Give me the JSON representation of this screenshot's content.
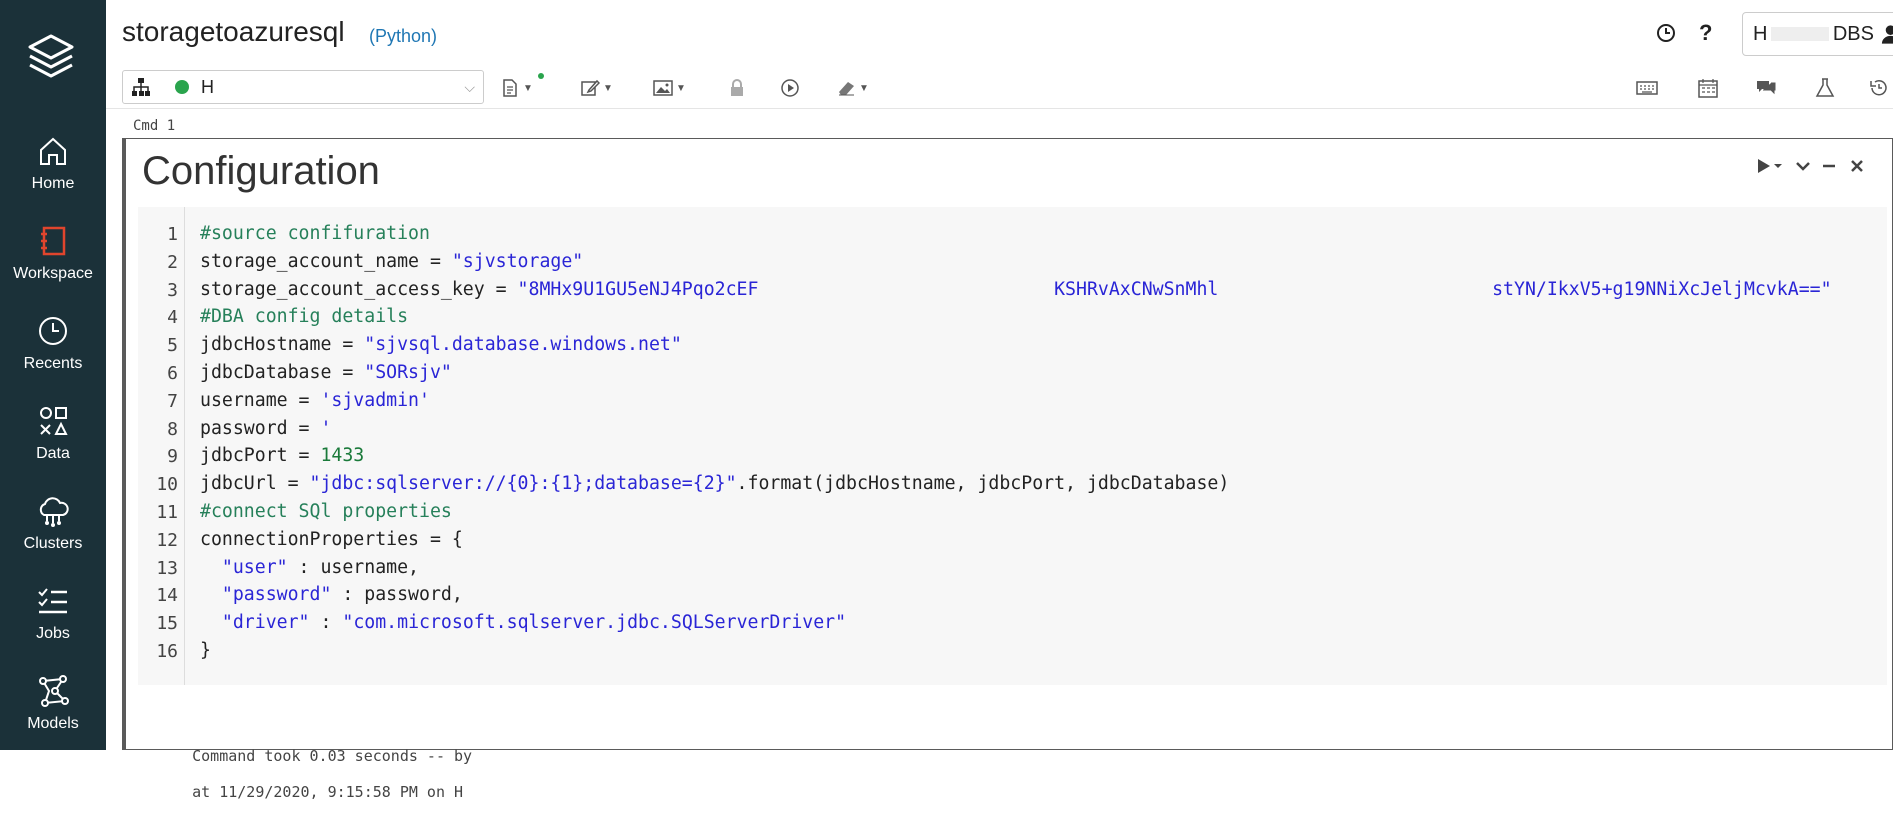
{
  "sidebar": {
    "items": [
      {
        "label": "Home",
        "icon": "home-icon"
      },
      {
        "label": "Workspace",
        "icon": "workspace-icon"
      },
      {
        "label": "Recents",
        "icon": "clock-icon"
      },
      {
        "label": "Data",
        "icon": "data-shapes-icon"
      },
      {
        "label": "Clusters",
        "icon": "cloud-icon"
      },
      {
        "label": "Jobs",
        "icon": "jobs-list-icon"
      },
      {
        "label": "Models",
        "icon": "models-icon"
      }
    ]
  },
  "header": {
    "title": "storagetoazuresql",
    "language": "(Python)",
    "help": "?",
    "user_left": "H",
    "user_right": "DBS"
  },
  "toolbar": {
    "cluster_name": "H",
    "cluster_status_color": "#2aa44d"
  },
  "cell": {
    "cmd_label": "Cmd 1",
    "title": "Configuration",
    "code": [
      [
        {
          "t": "#source confifuration",
          "c": "cm"
        }
      ],
      [
        {
          "t": "storage_account_name = ",
          "c": ""
        },
        {
          "t": "\"sjvstorage\"",
          "c": "st"
        }
      ],
      [
        {
          "t": "storage_account_access_key = ",
          "c": ""
        },
        {
          "t": "\"8MHx9U1GU5eNJ4Pqo2cEF",
          "c": "st"
        },
        {
          "t": "                           ",
          "c": ""
        },
        {
          "t": "KSHRvAxCNwSnMhl",
          "c": "st"
        },
        {
          "t": "                         ",
          "c": ""
        },
        {
          "t": "stYN/IkxV5+g19NNiXcJeljMcvkA==\"",
          "c": "st"
        }
      ],
      [
        {
          "t": "#DBA config details",
          "c": "cm"
        }
      ],
      [
        {
          "t": "jdbcHostname = ",
          "c": ""
        },
        {
          "t": "\"sjvsql.database.windows.net\"",
          "c": "st"
        }
      ],
      [
        {
          "t": "jdbcDatabase = ",
          "c": ""
        },
        {
          "t": "\"SORsjv\"",
          "c": "st"
        }
      ],
      [
        {
          "t": "username = ",
          "c": ""
        },
        {
          "t": "'sjvadmin'",
          "c": "st"
        }
      ],
      [
        {
          "t": "password = ",
          "c": ""
        },
        {
          "t": "'",
          "c": "st"
        }
      ],
      [
        {
          "t": "jdbcPort = ",
          "c": ""
        },
        {
          "t": "1433",
          "c": "nm"
        }
      ],
      [
        {
          "t": "jdbcUrl = ",
          "c": ""
        },
        {
          "t": "\"jdbc:sqlserver://{0}:{1};database={2}\"",
          "c": "st"
        },
        {
          "t": ".format(jdbcHostname, jdbcPort, jdbcDatabase)",
          "c": ""
        }
      ],
      [
        {
          "t": "#connect SQl properties",
          "c": "cm"
        }
      ],
      [
        {
          "t": "connectionProperties = {",
          "c": ""
        }
      ],
      [
        {
          "t": "  ",
          "c": ""
        },
        {
          "t": "\"user\"",
          "c": "st"
        },
        {
          "t": " : username,",
          "c": ""
        }
      ],
      [
        {
          "t": "  ",
          "c": ""
        },
        {
          "t": "\"password\"",
          "c": "st"
        },
        {
          "t": " : password,",
          "c": ""
        }
      ],
      [
        {
          "t": "  ",
          "c": ""
        },
        {
          "t": "\"driver\"",
          "c": "st"
        },
        {
          "t": " : ",
          "c": ""
        },
        {
          "t": "\"com.microsoft.sqlserver.jdbc.SQLServerDriver\"",
          "c": "st"
        }
      ],
      [
        {
          "t": "}",
          "c": ""
        }
      ]
    ],
    "footer_prefix": "Command took 0.03 seconds -- by",
    "footer_time": "at 11/29/2020, 9:15:58 PM on H"
  }
}
